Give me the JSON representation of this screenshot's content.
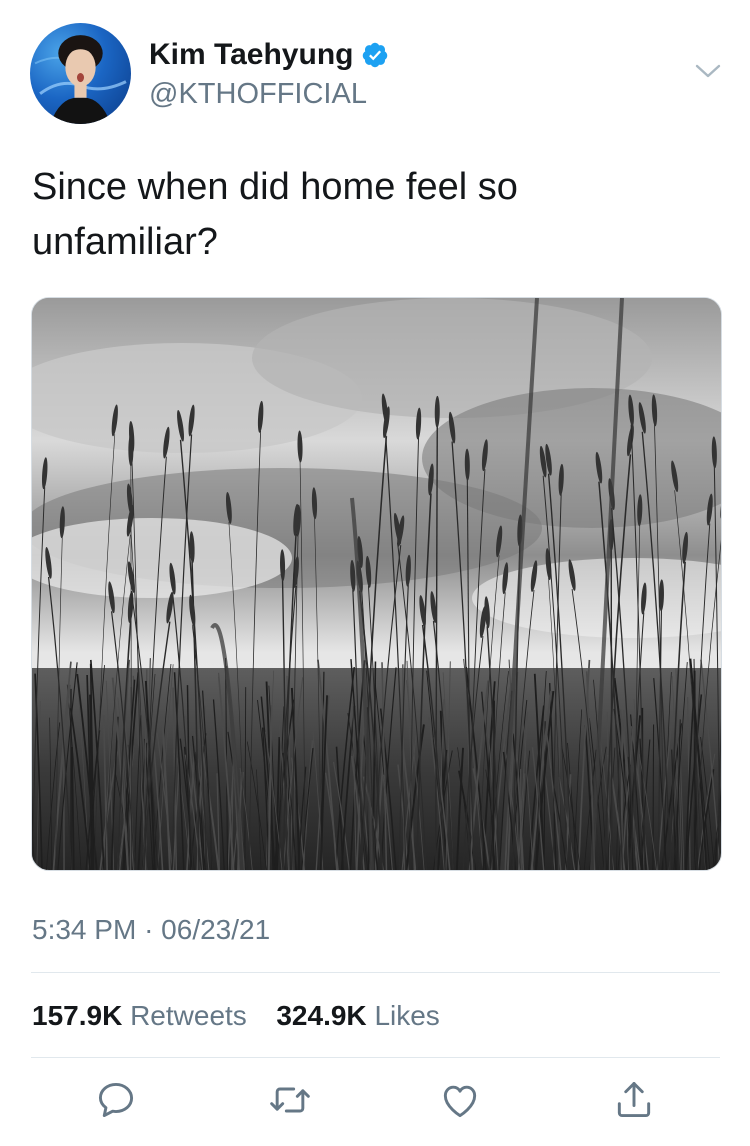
{
  "user": {
    "name": "Kim Taehyung",
    "handle": "@KTHOFFICIAL",
    "verified": true
  },
  "tweet": {
    "text": "Since when did home feel so unfamiliar?",
    "photo_description": "",
    "time": "5:34 PM",
    "separator": "·",
    "date": "06/23/21"
  },
  "stats": {
    "retweets_count": "157.9K",
    "retweets_label": "Retweets",
    "likes_count": "324.9K",
    "likes_label": "Likes"
  },
  "actions": [
    "reply-icon",
    "retweet-icon",
    "like-icon",
    "share-icon"
  ],
  "colors": {
    "text_primary": "#14171a",
    "text_secondary": "#657786",
    "verified_blue": "#1da1f2",
    "divider": "#e1e8ed"
  }
}
